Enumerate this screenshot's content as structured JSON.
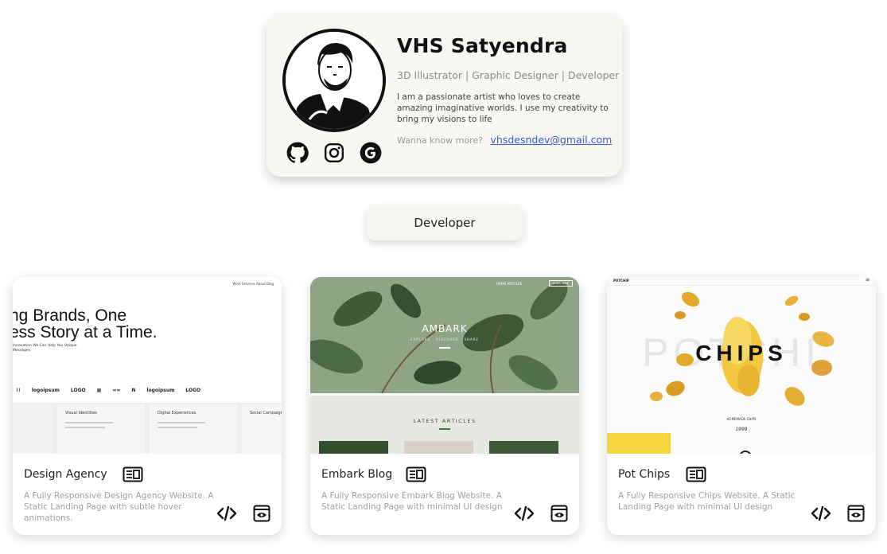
{
  "profile": {
    "name": "VHS Satyendra",
    "role": "3D Illustrator | Graphic Designer | Developer",
    "bio": "I am a passionate artist who loves to create amazing imaginative worlds. I use my creativity to bring my visions to life",
    "contact_prompt": "Wanna know more?",
    "email": "vhsdesndev@gmail.com",
    "socials": [
      "github-icon",
      "instagram-icon",
      "google-icon"
    ]
  },
  "filter": {
    "label": "Developer"
  },
  "cards": [
    {
      "title": "Design Agency",
      "description": "A Fully Responsive Design Agency Website. A Static Landing Page with subtle hover animations.",
      "thumb": {
        "headline_line1": "ng Brands, One",
        "headline_line2": "ess Story at a Time.",
        "subline": "Innovation We Can Help You Unique Messages",
        "nav": "Work  Services  About  Blog",
        "logos": [
          "logoipsum",
          "LOGO",
          "logoipsum",
          "LOGO"
        ],
        "panels": [
          "Visual Identities",
          "Digital Experiences",
          "Social Campaigns"
        ]
      }
    },
    {
      "title": "Embark Blog",
      "description": "A Fully Responsive Embark Blog Website. A Static Landing Page with minimal UI design",
      "thumb": {
        "brand": "AMBARK",
        "tagline": "EXPLORE · DISCOVER · SHARE",
        "section": "LATEST ARTICLES",
        "nav": "HOME   ARTICLES",
        "nav_button": "SUBSCRIBE"
      }
    },
    {
      "title": "Pot Chips",
      "description": "A Fully Responsive Chips Website. A Static Landing Page with minimal UI design",
      "thumb": {
        "logo": "POTCHIP",
        "bg_text": "POTCHI",
        "headline": "CHIPS",
        "subtitle": "HOMEMADE CHIPS",
        "year": "1999"
      }
    }
  ],
  "colors": {
    "card_bg": "#f8f7f3",
    "link": "#3a5bbf",
    "accent_yellow": "#f6d63c",
    "leaf_green": "#5b7a55"
  }
}
